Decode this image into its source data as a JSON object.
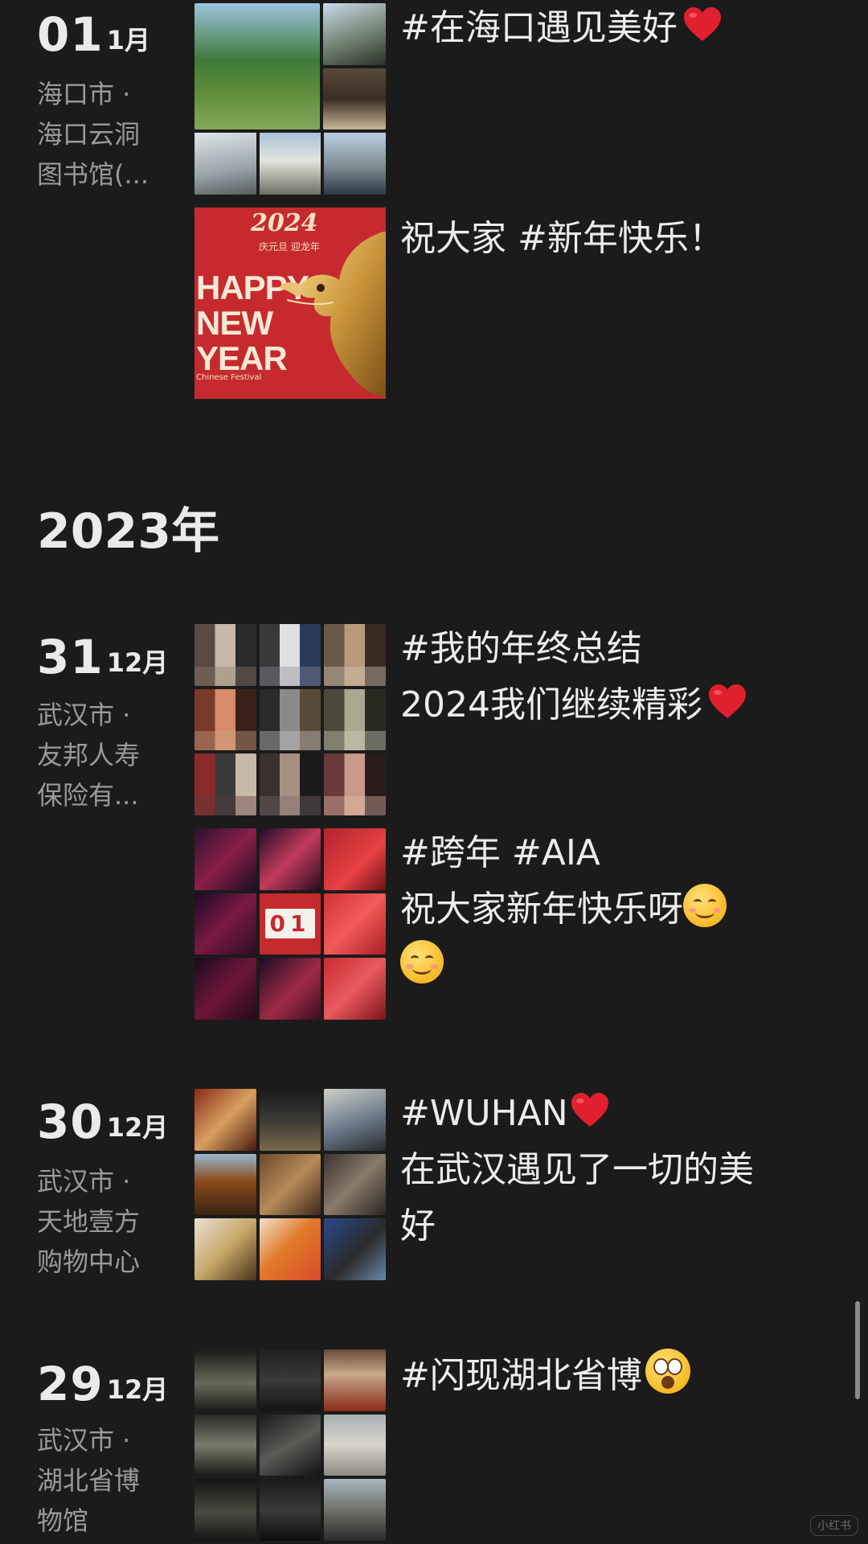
{
  "year_header": "2023年",
  "entries": [
    {
      "day": "01",
      "month": "1月",
      "location": [
        "海口市 ·",
        "海口云洞",
        "图书馆(..."
      ],
      "posts": [
        {
          "lines": [
            "#在海口遇见美好"
          ],
          "emoji": "heart"
        },
        {
          "lines": [
            "祝大家 #新年快乐！"
          ]
        }
      ]
    },
    {
      "day": "31",
      "month": "12月",
      "location": [
        "武汉市 ·",
        "友邦人寿",
        "保险有..."
      ],
      "posts": [
        {
          "lines": [
            "#我的年终总结",
            "2024我们继续精彩"
          ],
          "emoji": "heart"
        },
        {
          "lines": [
            "#跨年 #AIA",
            "祝大家新年快乐呀"
          ],
          "emoji": "smile"
        }
      ]
    },
    {
      "day": "30",
      "month": "12月",
      "location": [
        "武汉市 ·",
        "天地壹方",
        "购物中心"
      ],
      "posts": [
        {
          "lines": [
            "#WUHAN",
            "在武汉遇见了一切的美",
            "好"
          ],
          "emoji": "heart"
        }
      ]
    },
    {
      "day": "29",
      "month": "12月",
      "location": [
        "武汉市 ·",
        "湖北省博",
        "物馆"
      ],
      "posts": [
        {
          "lines": [
            "#闪现湖北省博"
          ],
          "emoji": "wow"
        }
      ]
    }
  ],
  "new_year_card": {
    "year_text": "2024",
    "sub_text": "庆元旦 迎龙年",
    "big_text": [
      "HAPPY",
      "NEW",
      "YEAR"
    ],
    "small_text": "Chinese Festival"
  },
  "counter_card_text": "01",
  "watermark": "小红书",
  "colors": {
    "background": "#1b1b1b",
    "text": "#ececec",
    "muted": "#9a9a9a",
    "heart": "#e0202e"
  }
}
